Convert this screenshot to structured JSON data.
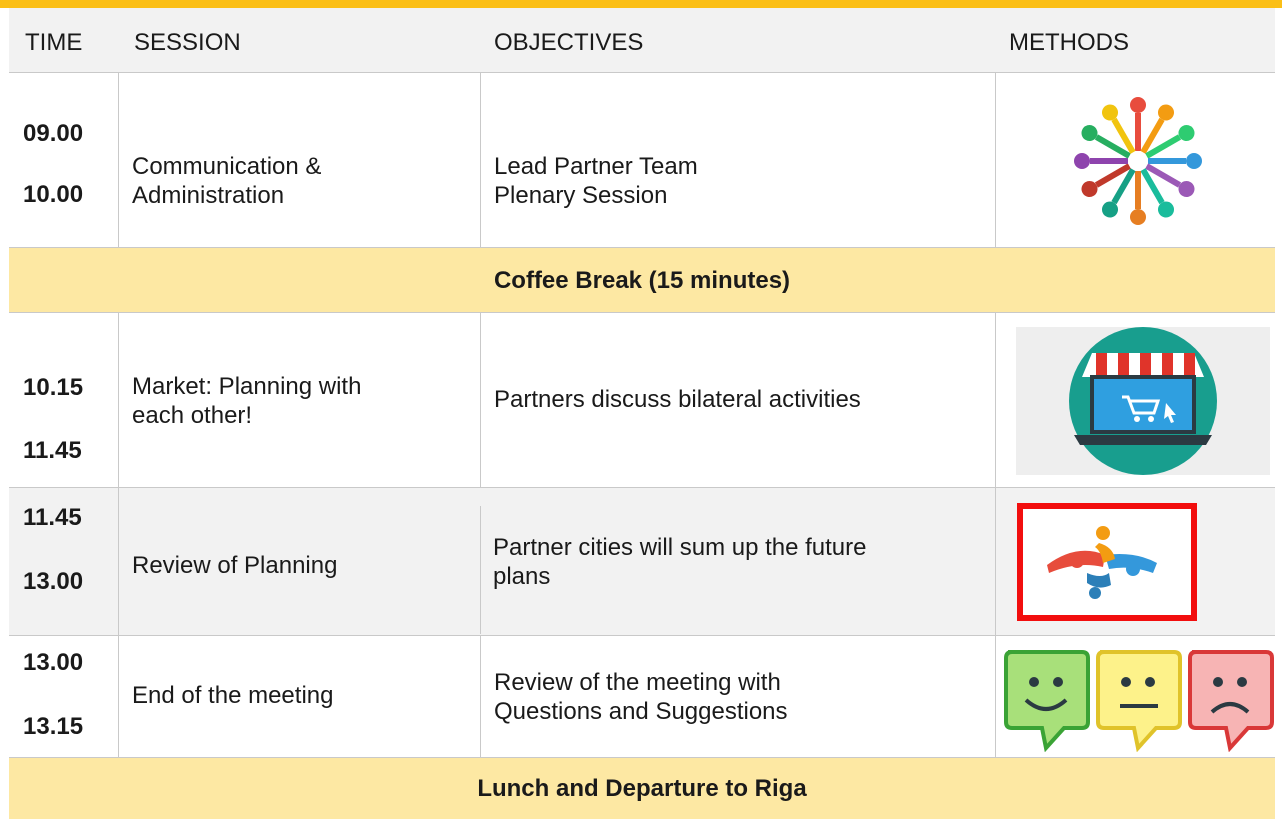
{
  "header": {
    "time": "TIME",
    "session": "SESSION",
    "objectives": "OBJECTIVES",
    "methods": "METHODS"
  },
  "rows": [
    {
      "start": "09.00",
      "end": "10.00",
      "session": [
        "Communication &",
        "Administration"
      ],
      "objectives": [
        "Lead Partner Team",
        "Plenary Session"
      ],
      "method_icon": "people-circle-icon"
    },
    {
      "start": "10.15",
      "end": "11.45",
      "session": [
        "Market: Planning with",
        "each other!"
      ],
      "objectives": [
        "Partners discuss bilateral activities"
      ],
      "method_icon": "online-shop-icon"
    },
    {
      "start": "11.45",
      "end": "13.00",
      "session": [
        "Review of Planning"
      ],
      "objectives": [
        "Partner cities will sum up the future",
        "plans"
      ],
      "method_icon": "teamwork-puzzle-icon"
    },
    {
      "start": "13.00",
      "end": "13.15",
      "session": [
        "End of the meeting"
      ],
      "objectives": [
        "Review of the meeting with",
        "Questions and Suggestions"
      ],
      "method_icon": "feedback-faces-icon"
    }
  ],
  "breaks": {
    "coffee": "Coffee Break (15 minutes)",
    "lunch": "Lunch and Departure to Riga"
  },
  "colors": {
    "accent_bar": "#fbbf16",
    "break_fill": "#fde8a3",
    "header_fill": "#f2f2f2",
    "highlight_frame": "#f20e0e"
  }
}
